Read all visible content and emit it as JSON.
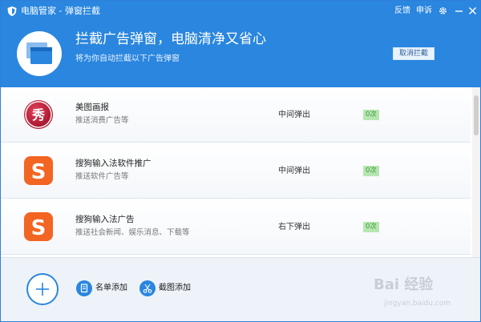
{
  "titlebar": {
    "title": "电脑管家 - 弹窗拦截",
    "feedback": "反馈",
    "appeal": "申诉",
    "icons": [
      "shield-icon",
      "gear-icon",
      "minimize-icon",
      "close-icon"
    ]
  },
  "hero": {
    "title": "拦截广告弹窗，电脑清净又省心",
    "subtitle": "将为你自动拦截以下广告弹窗",
    "cancel_label": "取消拦截",
    "icon": "windows-stack-icon"
  },
  "rows": [
    {
      "name": "美图画报",
      "desc": "推送消费广告等",
      "position": "中间弹出",
      "count": "0次",
      "logo_icon": "meitu-xiu-icon",
      "logo_char": "秀"
    },
    {
      "name": "搜狗输入法软件推广",
      "desc": "推送软件广告等",
      "position": "中间弹出",
      "count": "0次",
      "logo_icon": "sogou-icon",
      "logo_char": "S"
    },
    {
      "name": "搜狗输入法广告",
      "desc": "推送社会新闻、娱乐消息、下载等",
      "position": "右下弹出",
      "count": "0次",
      "logo_icon": "sogou-icon",
      "logo_char": "S"
    }
  ],
  "footer": {
    "add_icon": "plus-icon",
    "list_add": "名单添加",
    "screenshot_add": "截图添加"
  },
  "watermark": {
    "brand": "Bai 经验",
    "url": "jingyan.baidu.com"
  },
  "colors": {
    "accent": "#2a86de",
    "count_bg": "#b8e6b3",
    "count_text": "#3d9a3a"
  }
}
